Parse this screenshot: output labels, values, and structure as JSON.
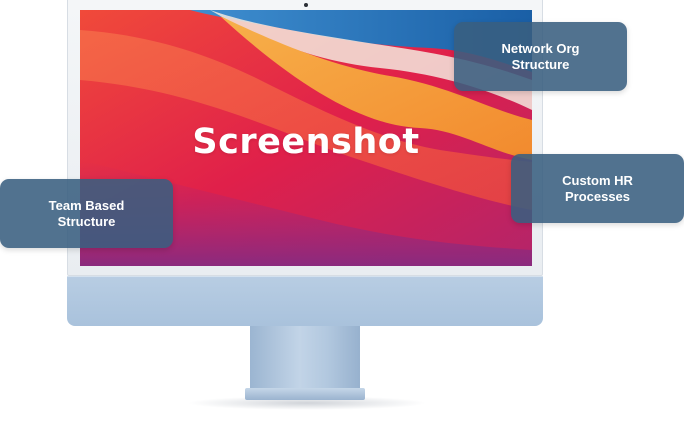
{
  "screen": {
    "label": "Screenshot"
  },
  "callouts": {
    "network_org": "Network Org\nStructure",
    "custom_hr": "Custom HR\nProcesses",
    "team_based": "Team Based\nStructure"
  },
  "colors": {
    "callout_bg": "#395f80",
    "imac_body": "#b0c7df",
    "wallpaper_red": "#d91c4a",
    "wallpaper_orange": "#f6a33e",
    "wallpaper_blue": "#1c6fb4"
  },
  "icons": {
    "camera": "camera-dot-icon"
  }
}
